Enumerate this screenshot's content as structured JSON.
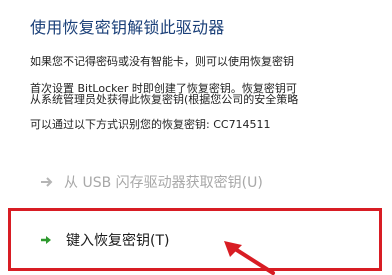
{
  "dialog": {
    "title": "使用恢复密钥解锁此驱动器",
    "info_lines": [
      "如果您不记得密码或没有智能卡，则可以使用恢复密钥",
      "首次设置 BitLocker 时即创建了恢复密钥。恢复密钥可",
      "从系统管理员处获得此恢复密钥(根据您公司的安全策略",
      "可以通过以下方式识别您的恢复密钥:  CC714511"
    ]
  },
  "options": {
    "usb": {
      "label": "从 USB 闪存驱动器获取密钥(U)",
      "icon": "arrow-right-icon",
      "state": "disabled"
    },
    "enter_key": {
      "label": "键入恢复密钥(T)",
      "icon": "green-arrow-right-icon"
    }
  },
  "colors": {
    "title": "#1a3f78",
    "disabled_text": "#a8a8a8",
    "highlight_border": "#d81d24",
    "enter_arrow": "#2e9a2e",
    "annotation_arrow": "#d81d24"
  }
}
